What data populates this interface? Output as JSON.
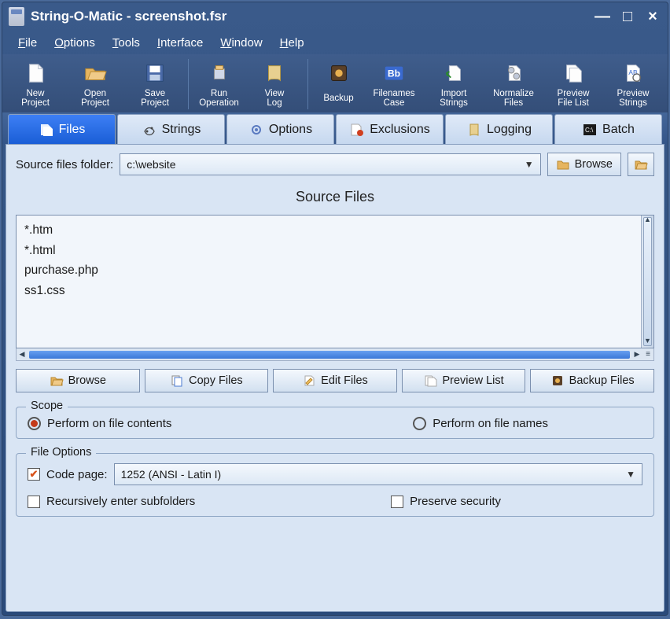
{
  "window": {
    "title": "String-O-Matic - screenshot.fsr"
  },
  "menu": {
    "file": "File",
    "options": "Options",
    "tools": "Tools",
    "interface": "Interface",
    "window": "Window",
    "help": "Help"
  },
  "toolbar": {
    "new_project": "New\nProject",
    "open_project": "Open\nProject",
    "save_project": "Save\nProject",
    "run_operation": "Run\nOperation",
    "view_log": "View\nLog",
    "backup": "Backup",
    "filenames_case": "Filenames\nCase",
    "import_strings": "Import\nStrings",
    "normalize_files": "Normalize\nFiles",
    "preview_filelist": "Preview\nFile List",
    "preview_strings": "Preview\nStrings"
  },
  "tabs": {
    "files": "Files",
    "strings": "Strings",
    "options": "Options",
    "exclusions": "Exclusions",
    "logging": "Logging",
    "batch": "Batch"
  },
  "source": {
    "label": "Source files folder:",
    "path": "c:\\website",
    "browse": "Browse"
  },
  "list": {
    "heading": "Source Files",
    "items": [
      "*.htm",
      "*.html",
      "purchase.php",
      "ss1.css"
    ]
  },
  "actions": {
    "browse": "Browse",
    "copy_files": "Copy Files",
    "edit_files": "Edit Files",
    "preview_list": "Preview List",
    "backup_files": "Backup Files"
  },
  "scope": {
    "legend": "Scope",
    "contents": "Perform on file contents",
    "names": "Perform on file names"
  },
  "file_options": {
    "legend": "File Options",
    "code_page_label": "Code page:",
    "code_page_value": "1252 (ANSI - Latin I)",
    "recursive": "Recursively enter subfolders",
    "preserve": "Preserve security"
  }
}
